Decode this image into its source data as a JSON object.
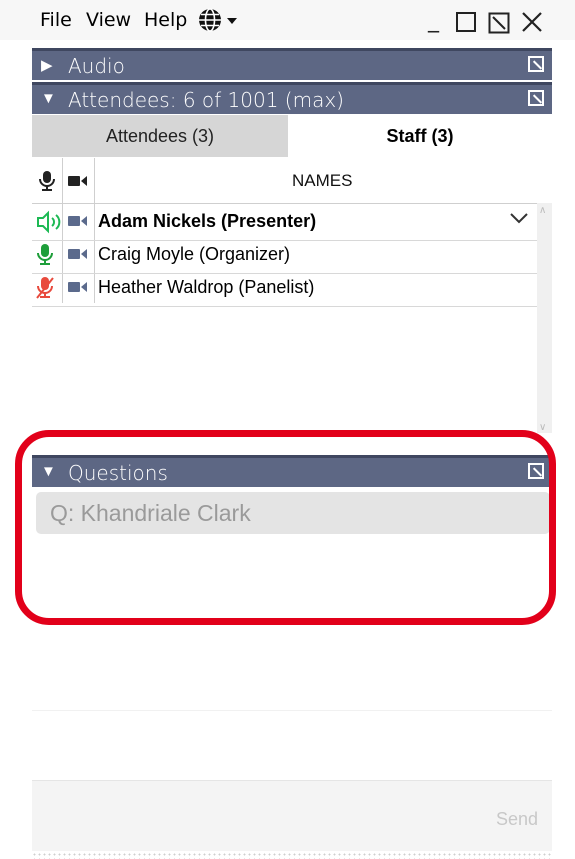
{
  "menubar": {
    "items": [
      "File",
      "View",
      "Help"
    ],
    "globe_icon": "globe-icon",
    "window_controls": [
      "minimize",
      "maximize",
      "restore",
      "close"
    ]
  },
  "panels": {
    "audio": {
      "title": "Audio",
      "collapsed": true
    },
    "attendees": {
      "title": "Attendees:  6 of 1001 (max)",
      "collapsed": false
    },
    "questions": {
      "title": "Questions",
      "collapsed": false
    }
  },
  "tabs": [
    {
      "label": "Attendees (3)",
      "selected": false
    },
    {
      "label": "Staff (3)",
      "selected": true
    }
  ],
  "grid": {
    "column_names": "NAMES",
    "rows": [
      {
        "name": "Adam Nickels (Presenter)",
        "bold": true,
        "mic_state": "speaking",
        "mic_color": "#1db954"
      },
      {
        "name": "Craig Moyle (Organizer)",
        "bold": false,
        "mic_state": "unmuted",
        "mic_color": "#1e9e3a"
      },
      {
        "name": "Heather Waldrop (Panelist)",
        "bold": false,
        "mic_state": "muted",
        "mic_color": "#e84a3d"
      }
    ]
  },
  "questions": {
    "items": [
      "Q: Khandriale Clark"
    ]
  },
  "compose": {
    "send_label": "Send"
  },
  "colors": {
    "panel_header": "#5d6784",
    "highlight": "#e2001a",
    "camera_icon": "#5b6a8c"
  }
}
